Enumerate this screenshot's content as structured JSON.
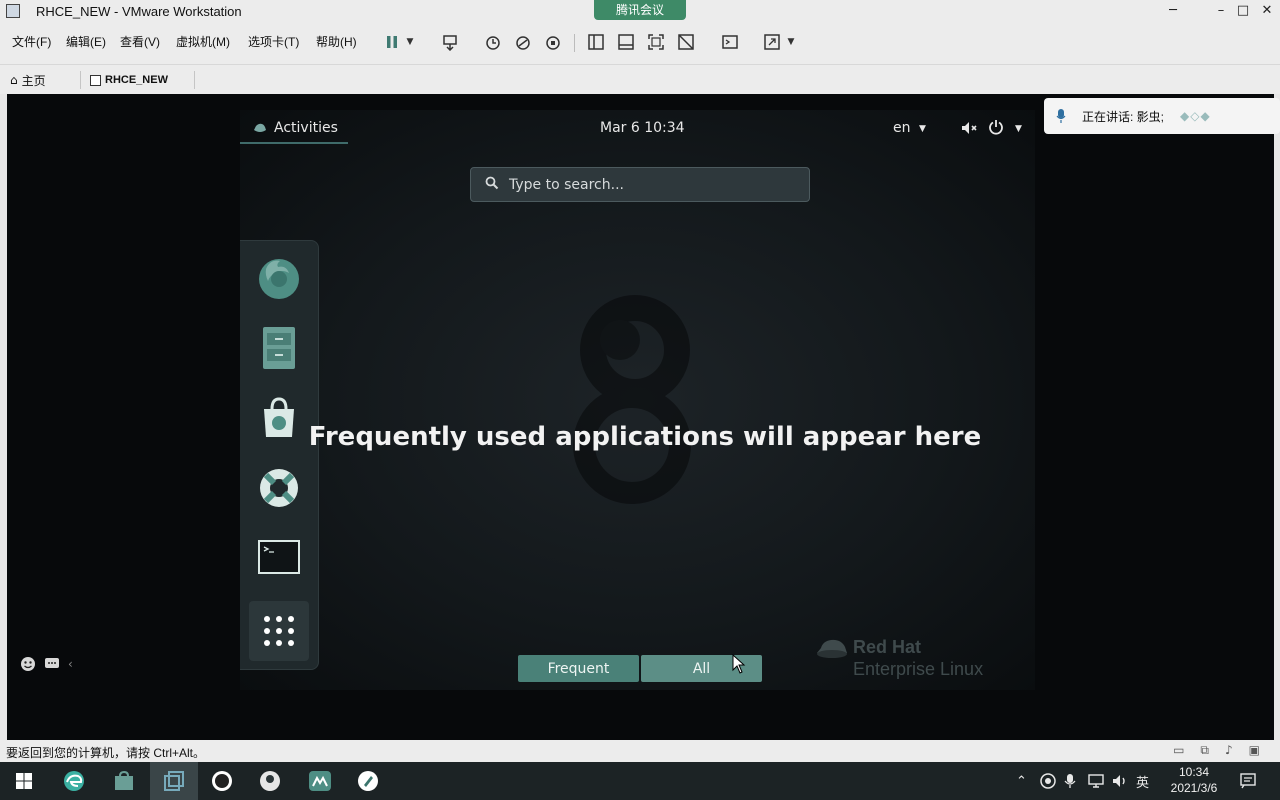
{
  "window": {
    "title": "RHCE_NEW - VMware Workstation",
    "meeting_tab": "腾讯会议",
    "minimize": "─",
    "maximize": "□",
    "close": "✕"
  },
  "menu": [
    "文件(F)",
    "编辑(E)",
    "查看(V)",
    "虚拟机(M)",
    "选项卡(T)",
    "帮助(H)"
  ],
  "tabs": {
    "home_label": "主页",
    "vm_label": "RHCE_NEW"
  },
  "gnome": {
    "activities": "Activities",
    "clock": "Mar 6  10:34",
    "lang": "en",
    "search_placeholder": "Type to search...",
    "empty_message": "Frequently used applications will appear here",
    "view_frequent": "Frequent",
    "view_all": "All",
    "active_view": "All",
    "brand_line1": "Red Hat",
    "brand_line2": "Enterprise Linux",
    "dash_apps": [
      "firefox-icon",
      "files-icon",
      "software-icon",
      "help-icon",
      "terminal-icon",
      "show-apps-icon"
    ]
  },
  "meeting": {
    "speaking": "正在讲话: 影虫;"
  },
  "status": {
    "message": "要返回到您的计算机，请按 Ctrl+Alt。"
  },
  "taskbar": {
    "apps": [
      "windows-start-icon",
      "edge-icon",
      "store-icon",
      "vmware-icon",
      "obs-icon",
      "browser-icon",
      "meeting-icon",
      "notes-icon"
    ],
    "ime": "英",
    "time": "10:34",
    "date": "2021/3/6"
  },
  "colors": {
    "accent_teal": "#4a8178",
    "meeting_green": "#3e8a67",
    "taskbar": "#1c2325"
  }
}
